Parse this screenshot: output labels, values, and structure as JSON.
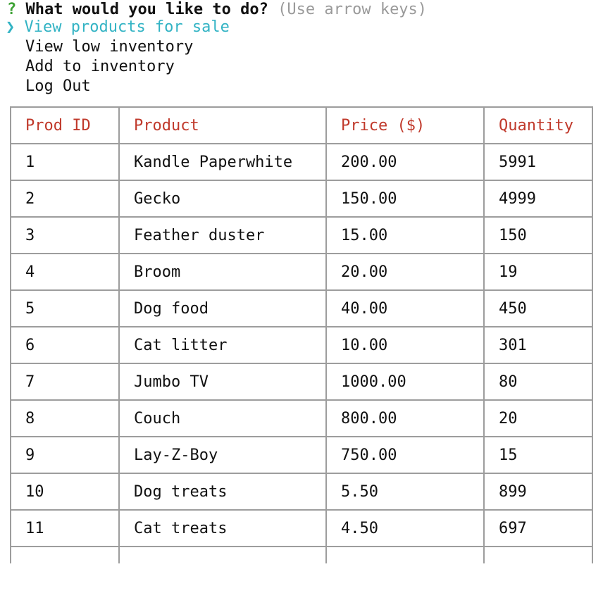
{
  "prompt": {
    "marker": "?",
    "question": "What would you like to do?",
    "hint": "(Use arrow keys)"
  },
  "menu": {
    "pointer": "❯",
    "items": [
      {
        "label": "View products for sale",
        "selected": true
      },
      {
        "label": "View low inventory",
        "selected": false
      },
      {
        "label": "Add to inventory",
        "selected": false
      },
      {
        "label": "Log Out",
        "selected": false
      }
    ]
  },
  "table": {
    "headers": [
      "Prod ID",
      "Product",
      "Price ($)",
      "Quantity"
    ],
    "rows": [
      [
        "1",
        "Kandle Paperwhite",
        "200.00",
        "5991"
      ],
      [
        "2",
        "Gecko",
        "150.00",
        "4999"
      ],
      [
        "3",
        "Feather duster",
        "15.00",
        "150"
      ],
      [
        "4",
        "Broom",
        "20.00",
        "19"
      ],
      [
        "5",
        "Dog food",
        "40.00",
        "450"
      ],
      [
        "6",
        "Cat litter",
        "10.00",
        "301"
      ],
      [
        "7",
        "Jumbo TV",
        "1000.00",
        "80"
      ],
      [
        "8",
        "Couch",
        "800.00",
        "20"
      ],
      [
        "9",
        "Lay-Z-Boy",
        "750.00",
        "15"
      ],
      [
        "10",
        "Dog treats",
        "5.50",
        "899"
      ],
      [
        "11",
        "Cat treats",
        "4.50",
        "697"
      ]
    ]
  },
  "colors": {
    "prompt_marker": "#3fa336",
    "selection": "#32b3c4",
    "header_text": "#c0392b",
    "hint": "#9a9a9a",
    "border": "#9d9d9d"
  }
}
